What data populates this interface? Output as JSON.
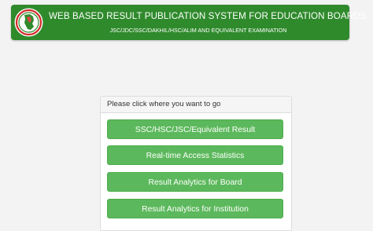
{
  "header": {
    "title": "WEB BASED RESULT PUBLICATION SYSTEM FOR EDUCATION BOARDS",
    "subtitle": "JSC/JDC/SSC/DAKHIL/HSC/ALIM AND EQUIVALENT EXAMINATION",
    "logo_icon": "government-seal-icon",
    "colors": {
      "header_bg": "#2f8a2c",
      "button_bg": "#5cb85c",
      "seal_red": "#d42a2a"
    }
  },
  "panel": {
    "heading": "Please click where you want to go",
    "buttons": [
      "SSC/HSC/JSC/Equivalent Result",
      "Real-time Access Statistics",
      "Result Analytics for Board",
      "Result Analytics for Institution"
    ]
  }
}
